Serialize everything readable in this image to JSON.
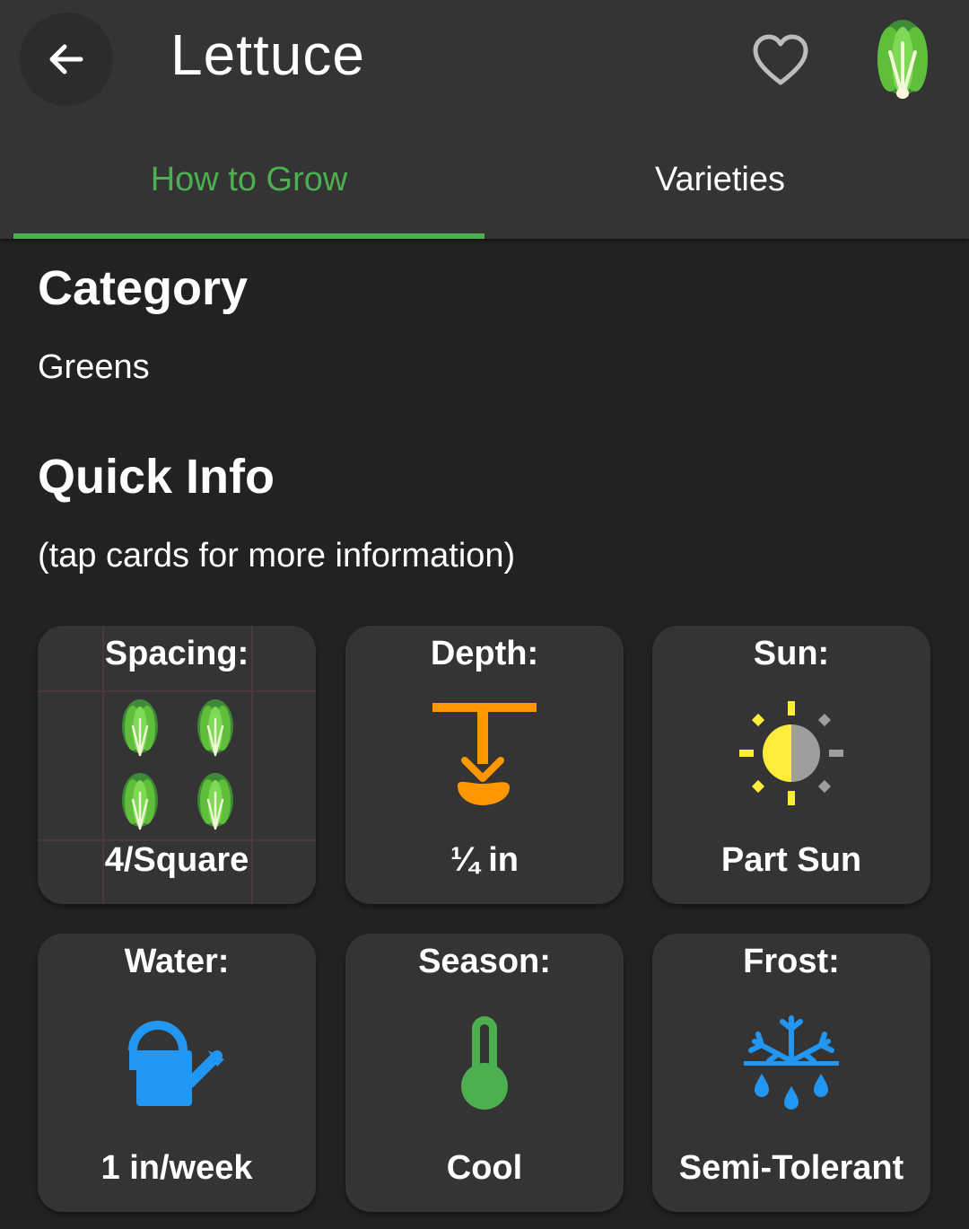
{
  "header": {
    "title": "Lettuce",
    "back_icon": "arrow-back-icon",
    "favorite_icon": "heart-outline-icon",
    "plant_icon": "lettuce-icon"
  },
  "tabs": [
    {
      "label": "How to Grow",
      "active": true
    },
    {
      "label": "Varieties",
      "active": false
    }
  ],
  "category": {
    "heading": "Category",
    "value": "Greens"
  },
  "quick_info": {
    "heading": "Quick Info",
    "hint": "(tap cards for more information)",
    "cards": [
      {
        "label": "Spacing:",
        "value": "4/Square",
        "icon": "lettuce-grid-icon"
      },
      {
        "label": "Depth:",
        "value": "¼ in",
        "icon": "seed-depth-icon"
      },
      {
        "label": "Sun:",
        "value": "Part Sun",
        "icon": "part-sun-icon"
      },
      {
        "label": "Water:",
        "value": "1 in/week",
        "icon": "watering-can-icon"
      },
      {
        "label": "Season:",
        "value": "Cool",
        "icon": "thermometer-icon"
      },
      {
        "label": "Frost:",
        "value": "Semi-Tolerant",
        "icon": "frost-icon"
      }
    ]
  },
  "colors": {
    "accent": "#4caf50",
    "background": "#222222",
    "appbar": "#343434",
    "card": "#343434",
    "depth": "#ff9800",
    "water": "#2196f3",
    "sun": "#ffeb3b"
  }
}
